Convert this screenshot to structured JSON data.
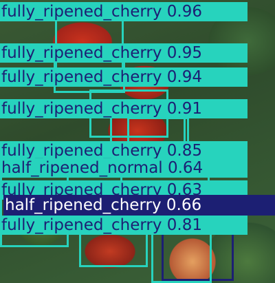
{
  "detections": [
    {
      "class": "fully_ripened_cherry",
      "score": "0.96"
    },
    {
      "class": "fully_ripened_cherry",
      "score": "0.95"
    },
    {
      "class": "fully_ripened_cherry",
      "score": "0.94"
    },
    {
      "class": "fully_ripened_cherry",
      "score": "0.91"
    },
    {
      "class": "fully_ripened_cherry",
      "score": "0.85"
    },
    {
      "class": "half_ripened_normal",
      "score": "0.64"
    },
    {
      "class": "fully_ripened_cherry",
      "score": "0.63"
    },
    {
      "class": "half_ripened_cherry",
      "score": "0.66"
    },
    {
      "class": "fully_ripened_cherry",
      "score": "0.81"
    }
  ],
  "colors": {
    "fully_ripened": "#27d3bd",
    "half_ripened": "#1c1f73"
  }
}
